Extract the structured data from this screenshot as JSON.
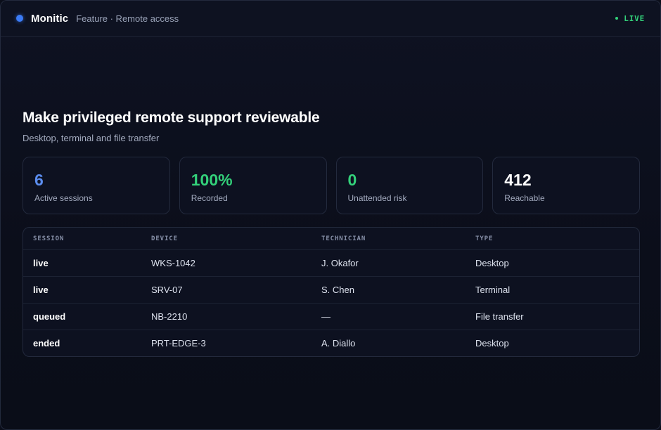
{
  "header": {
    "brand": "Monitic",
    "breadcrumb": "Feature · Remote access",
    "status": "LIVE"
  },
  "main": {
    "title": "Make privileged remote support reviewable",
    "subtitle": "Desktop, terminal and file transfer"
  },
  "stats": [
    {
      "value": "6",
      "label": "Active sessions",
      "color": "#5b8def"
    },
    {
      "value": "100%",
      "label": "Recorded",
      "color": "#33d17a"
    },
    {
      "value": "0",
      "label": "Unattended risk",
      "color": "#33d17a"
    },
    {
      "value": "412",
      "label": "Reachable",
      "color": "#ffffff"
    }
  ],
  "table": {
    "columns": [
      "SESSION",
      "DEVICE",
      "TECHNICIAN",
      "TYPE"
    ],
    "rows": [
      {
        "session": "live",
        "device": "WKS-1042",
        "technician": "J. Okafor",
        "type": "Desktop"
      },
      {
        "session": "live",
        "device": "SRV-07",
        "technician": "S. Chen",
        "type": "Terminal"
      },
      {
        "session": "queued",
        "device": "NB-2210",
        "technician": "—",
        "type": "File transfer"
      },
      {
        "session": "ended",
        "device": "PRT-EDGE-3",
        "technician": "A. Diallo",
        "type": "Desktop"
      }
    ]
  },
  "colors": {
    "accent": "#3b7bf6",
    "live": "#33d17a",
    "background": "#0b0e1a"
  }
}
